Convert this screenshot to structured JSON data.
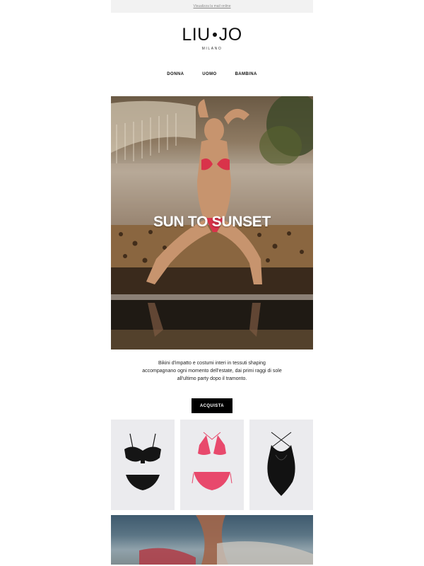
{
  "topbar": {
    "view_online": "Visualizza la mail online"
  },
  "logo": {
    "main_left": "LIU",
    "main_right": "JO",
    "sub": "MILANO"
  },
  "nav": {
    "items": [
      "DONNA",
      "UOMO",
      "BAMBINA"
    ]
  },
  "hero": {
    "title": "SUN TO SUNSET"
  },
  "intro": {
    "text": "Bikini d'impatto e costumi interi in tessuti shaping accompagnano ogni momento dell'estate, dai primi raggi di sole all'ultimo party dopo il tramonto."
  },
  "cta": {
    "label": "ACQUISTA"
  },
  "products": [
    {
      "name": "black-bikini",
      "color": "#151515"
    },
    {
      "name": "pink-triangle-bikini",
      "color": "#e8496c"
    },
    {
      "name": "black-one-piece",
      "color": "#121212"
    }
  ],
  "colors": {
    "accent": "#000000",
    "product_bg": "#ebebee",
    "topbar_bg": "#f2f2f2"
  }
}
